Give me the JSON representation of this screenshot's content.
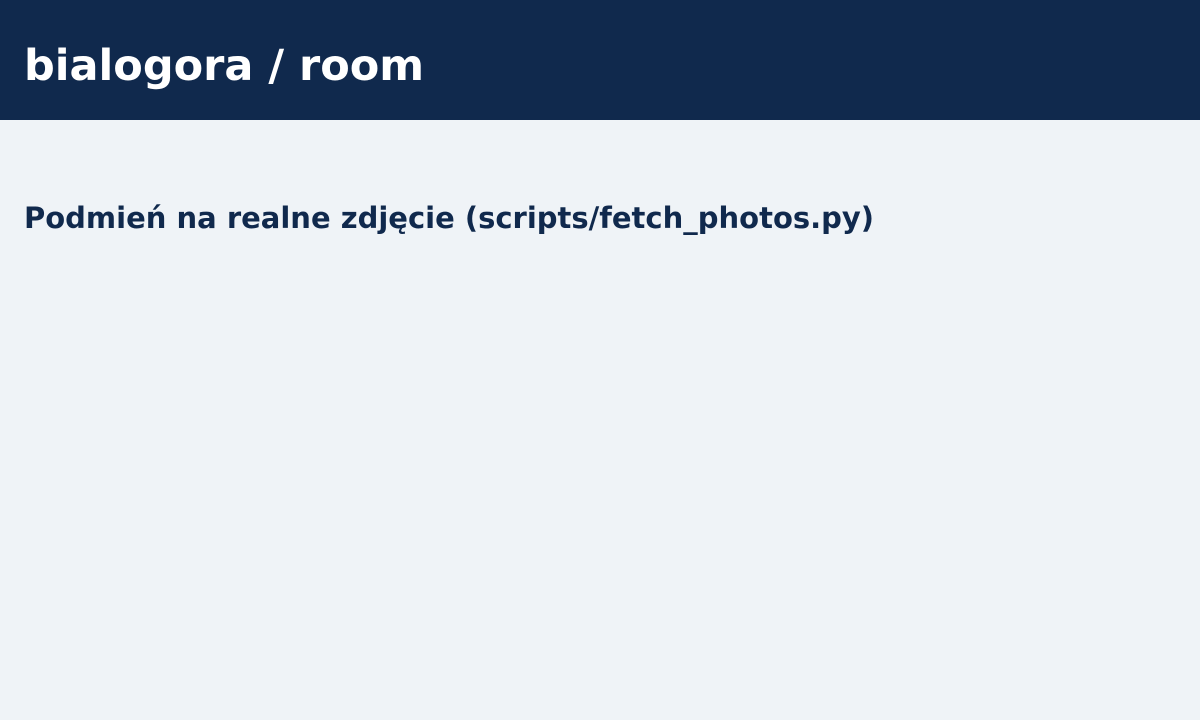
{
  "header": {
    "title": "bialogora / room",
    "background_color": "#10294d",
    "text_color": "#ffffff"
  },
  "main": {
    "placeholder_text": "Podmień na realne zdjęcie (scripts/fetch_photos.py)",
    "background_color": "#eff3f7",
    "text_color": "#10294d"
  }
}
